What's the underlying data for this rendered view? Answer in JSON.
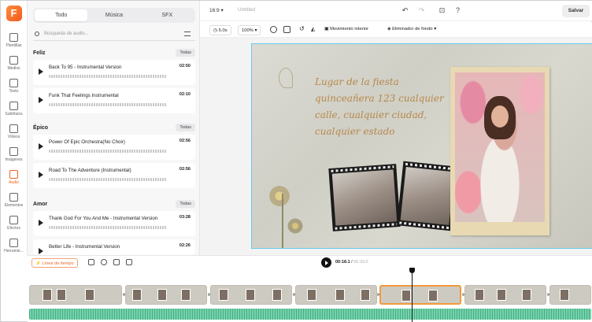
{
  "rail": {
    "logo": "F",
    "items": [
      {
        "label": "Plantillas",
        "icon": "templates-icon"
      },
      {
        "label": "Medios",
        "icon": "media-icon"
      },
      {
        "label": "Texto",
        "icon": "text-icon"
      },
      {
        "label": "Subtítulos",
        "icon": "subtitles-icon"
      },
      {
        "label": "Vídeos",
        "icon": "video-icon"
      },
      {
        "label": "Imágenes",
        "icon": "image-icon"
      },
      {
        "label": "Audio",
        "icon": "audio-icon",
        "active": true
      },
      {
        "label": "Elementos",
        "icon": "elements-icon"
      },
      {
        "label": "Efectos",
        "icon": "effects-icon"
      },
      {
        "label": "Herramie...",
        "icon": "tools-icon"
      }
    ]
  },
  "library": {
    "tabs": [
      "Todo",
      "Música",
      "SFX"
    ],
    "active_tab": "Todo",
    "search_placeholder": "Búsqueda de audio...",
    "all_label": "Todas",
    "sections": [
      {
        "title": "Feliz",
        "tracks": [
          {
            "name": "Back To 95 - Instrumental Version",
            "duration": "02:50"
          },
          {
            "name": "Funk That Feelings Instrumental",
            "duration": "02:10"
          }
        ]
      },
      {
        "title": "Épico",
        "tracks": [
          {
            "name": "Power Of Epic Orchestra(No Choir)",
            "duration": "02:56"
          },
          {
            "name": "Road To The Adventure (Instrumental)",
            "duration": "02:56"
          }
        ]
      },
      {
        "title": "Amor",
        "tracks": [
          {
            "name": "Thank God For You And Me - Instrumental Version",
            "duration": "03:28"
          },
          {
            "name": "Better Life - Instrumental Version",
            "duration": "02:26"
          }
        ]
      }
    ]
  },
  "header": {
    "ratio": "16:9",
    "title": "Untitled",
    "save_label": "Salvar"
  },
  "toolbar": {
    "duration": "5.0s",
    "zoom": "100%",
    "motion_label": "Movimiento interior",
    "bg_remove_label": "Eliminador de fondo"
  },
  "canvas": {
    "invite_text": "Lugar de la fiesta quinceañera 123 cualquier calle, cualquier ciudad, cualquier estado"
  },
  "timeline": {
    "badge": "Línea de tiempo",
    "current_time": "00:18.1",
    "total_time": "00:33.0"
  },
  "colors": {
    "accent": "#f2641f",
    "selection": "#f39a3c",
    "audio_track": "#74d3ac",
    "canvas_border": "#68c9e8"
  }
}
